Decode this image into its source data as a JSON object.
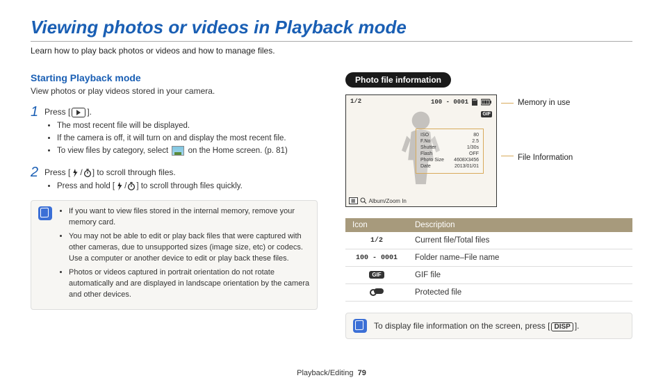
{
  "page": {
    "title": "Viewing photos or videos in Playback mode",
    "intro": "Learn how to play back photos or videos and how to manage files.",
    "footer_section": "Playback/Editing",
    "footer_page": "79"
  },
  "left": {
    "heading": "Starting Playback mode",
    "subintro": "View photos or play videos stored in your camera.",
    "step1": {
      "num": "1",
      "prefix": "Press [",
      "suffix": "].",
      "b1": "The most recent file will be displayed.",
      "b2": "If the camera is off, it will turn on and display the most recent file.",
      "b3_pre": "To view files by category, select ",
      "b3_post": " on the Home screen. (p. 81)"
    },
    "step2": {
      "num": "2",
      "prefix": "Press [",
      "slash": "/",
      "suffix": "] to scroll through files.",
      "b1_pre": "Press and hold [",
      "b1_mid": "/",
      "b1_post": "] to scroll through files quickly."
    },
    "note_items": [
      "If you want to view files stored in the internal memory, remove your memory card.",
      "You may not be able to edit or play back files that were captured with other cameras, due to unsupported sizes (image size, etc) or codecs. Use a computer or another device to edit or play back these files.",
      "Photos or videos captured in portrait orientation do not rotate automatically and are displayed in landscape orientation by the camera and other devices."
    ]
  },
  "right": {
    "pill": "Photo file information",
    "lcd": {
      "file_counter": "1/2",
      "folder_file": "100 - 0001",
      "gif_badge": "GIF",
      "info_rows": [
        {
          "k": "ISO",
          "v": "80"
        },
        {
          "k": "F.No",
          "v": "2.5"
        },
        {
          "k": "Shutter",
          "v": "1/30s"
        },
        {
          "k": "Flash",
          "v": "OFF"
        },
        {
          "k": "Photo Size",
          "v": "4608X3456"
        },
        {
          "k": "Date",
          "v": "2013/01/01"
        }
      ],
      "bottom_label": "Album/Zoom In"
    },
    "callout1": "Memory in use",
    "callout2": "File Information",
    "table": {
      "h1": "Icon",
      "h2": "Description",
      "rows": [
        {
          "icon_text": "1/2",
          "desc": "Current file/Total files",
          "type": "text"
        },
        {
          "icon_text": "100 - 0001",
          "desc": "Folder name–File name",
          "type": "text"
        },
        {
          "icon_text": "GIF",
          "desc": "GIF file",
          "type": "gif"
        },
        {
          "icon_text": "",
          "desc": "Protected file",
          "type": "lock"
        }
      ]
    },
    "note2_pre": "To display file information on the screen, press [",
    "note2_btn": "DISP",
    "note2_post": "]."
  }
}
